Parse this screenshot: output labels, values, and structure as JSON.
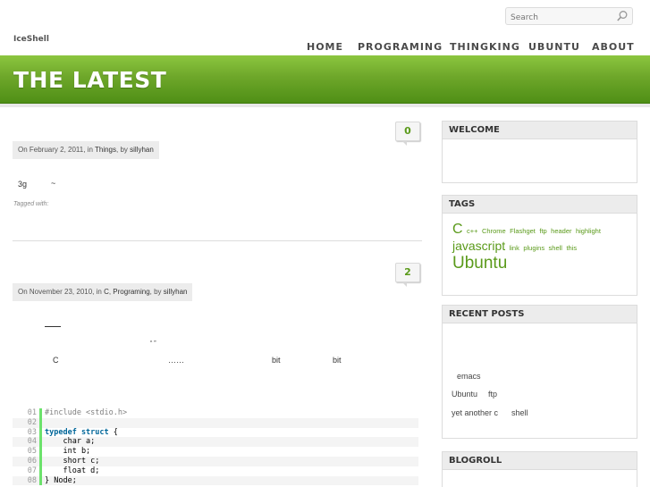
{
  "header": {
    "search_placeholder": "Search",
    "site_title": "IceShell",
    "nav": [
      "HOME",
      "PROGRAMING",
      "THINGKING",
      "UBUNTU",
      "ABOUT"
    ]
  },
  "banner": {
    "title": "THE LATEST"
  },
  "posts": [
    {
      "comments": "0",
      "meta_prefix": "On February 2, 2011, in ",
      "category": "Things",
      "meta_by": ", by ",
      "author": "sillyhan",
      "body_1": "3g",
      "body_2": "~",
      "tagged": "Tagged with:"
    },
    {
      "comments": "2",
      "meta_prefix": "On November 23, 2010, in ",
      "category_1": "C",
      "sep": ", ",
      "category_2": "Programing",
      "meta_by": ", by ",
      "author": "sillyhan",
      "frag_quotes": "“ ”",
      "frag_c": "C",
      "frag_dots": "……",
      "frag_bit1": "bit",
      "frag_bit2": "bit"
    }
  ],
  "code": [
    {
      "num": "01",
      "text": "#include <stdio.h>",
      "type": "pre"
    },
    {
      "num": "02",
      "text": "",
      "type": "plain"
    },
    {
      "num": "03",
      "kw": "typedef struct",
      "text": " {",
      "type": "kw"
    },
    {
      "num": "04",
      "text": "    char a;",
      "type": "plain"
    },
    {
      "num": "05",
      "text": "    int b;",
      "type": "plain"
    },
    {
      "num": "06",
      "text": "    short c;",
      "type": "plain"
    },
    {
      "num": "07",
      "text": "    float d;",
      "type": "plain"
    },
    {
      "num": "08",
      "text": "} Node;",
      "type": "plain"
    }
  ],
  "sidebar": {
    "welcome_title": "WELCOME",
    "tags_title": "TAGS",
    "tags": {
      "c": "C",
      "cpp": "c++",
      "chrome": "Chrome",
      "flashget": "Flashget",
      "ftp": "ftp",
      "header": "header",
      "highlight": "highlight",
      "javascript": "javascript",
      "link": "link",
      "plugins": "plugins",
      "shell": "shell",
      "this": "this",
      "ubuntu": "Ubuntu"
    },
    "recent_title": "RECENT POSTS",
    "recent": [
      "emacs",
      "Ubuntu",
      "ftp",
      "yet another c",
      "shell"
    ],
    "blogroll_title": "BLOGROLL"
  },
  "colors": {
    "accent": "#5a9a1a",
    "banner": "#6ea72a"
  }
}
